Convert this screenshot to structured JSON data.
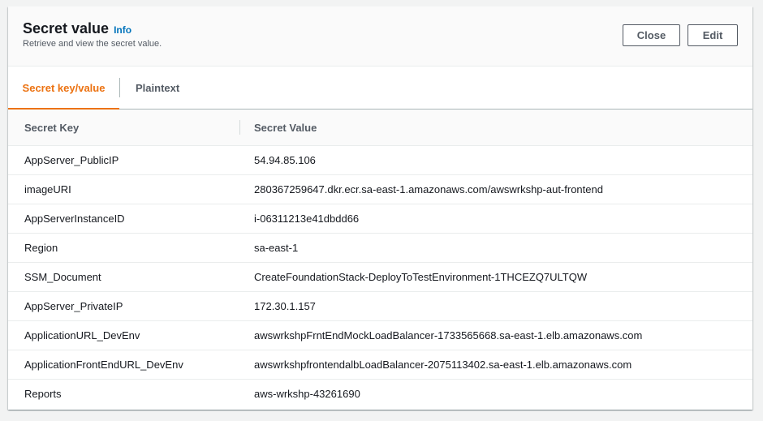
{
  "panel": {
    "title": "Secret value",
    "info_link": "Info",
    "subtitle": "Retrieve and view the secret value.",
    "close_label": "Close",
    "edit_label": "Edit"
  },
  "tabs": [
    {
      "label": "Secret key/value",
      "active": true
    },
    {
      "label": "Plaintext",
      "active": false
    }
  ],
  "table": {
    "columns": [
      "Secret Key",
      "Secret Value"
    ],
    "rows": [
      {
        "key": "AppServer_PublicIP",
        "value": "54.94.85.106"
      },
      {
        "key": "imageURI",
        "value": "280367259647.dkr.ecr.sa-east-1.amazonaws.com/awswrkshp-aut-frontend"
      },
      {
        "key": "AppServerInstanceID",
        "value": "i-06311213e41dbdd66"
      },
      {
        "key": "Region",
        "value": "sa-east-1"
      },
      {
        "key": "SSM_Document",
        "value": "CreateFoundationStack-DeployToTestEnvironment-1THCEZQ7ULTQW"
      },
      {
        "key": "AppServer_PrivateIP",
        "value": "172.30.1.157"
      },
      {
        "key": "ApplicationURL_DevEnv",
        "value": "awswrkshpFrntEndMockLoadBalancer-1733565668.sa-east-1.elb.amazonaws.com"
      },
      {
        "key": "ApplicationFrontEndURL_DevEnv",
        "value": "awswrkshpfrontendalbLoadBalancer-2075113402.sa-east-1.elb.amazonaws.com"
      },
      {
        "key": "Reports",
        "value": "aws-wrkshp-43261690"
      }
    ]
  },
  "colors": {
    "accent": "#ec7211",
    "link": "#0073bb",
    "text": "#16191f",
    "muted": "#545b64"
  }
}
